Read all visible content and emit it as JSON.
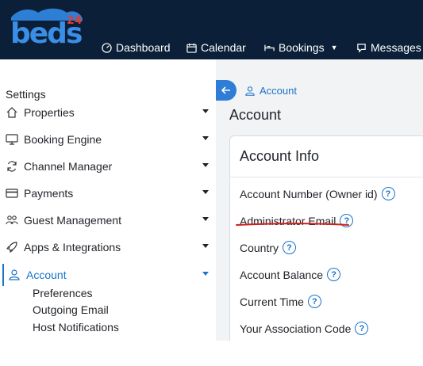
{
  "brand": {
    "logo_text": "beds",
    "logo_badge": "24"
  },
  "nav": {
    "items": [
      {
        "label": "Dashboard",
        "icon": "gauge-icon"
      },
      {
        "label": "Calendar",
        "icon": "calendar-icon"
      },
      {
        "label": "Bookings",
        "icon": "bookings-icon",
        "dropdown": true
      },
      {
        "label": "Messages",
        "icon": "message-icon"
      }
    ]
  },
  "sidebar": {
    "title": "Settings",
    "items": [
      {
        "label": "Properties",
        "icon": "home-icon"
      },
      {
        "label": "Booking Engine",
        "icon": "monitor-icon"
      },
      {
        "label": "Channel Manager",
        "icon": "sync-icon"
      },
      {
        "label": "Payments",
        "icon": "card-icon"
      },
      {
        "label": "Guest Management",
        "icon": "users-icon"
      },
      {
        "label": "Apps & Integrations",
        "icon": "rocket-icon"
      },
      {
        "label": "Account",
        "icon": "user-icon",
        "active": true
      }
    ],
    "submenu": [
      "Preferences",
      "Outgoing Email",
      "Host Notifications"
    ]
  },
  "main": {
    "breadcrumb": "Account",
    "title": "Account",
    "card_title": "Account Info",
    "fields": [
      "Account Number (Owner id)",
      "Administrator Email",
      "Country",
      "Account Balance",
      "Current Time",
      "Your Association Code"
    ],
    "help_glyph": "?"
  },
  "colors": {
    "topbar": "#0b2038",
    "accent": "#1a73c8",
    "annotation": "#d0201a",
    "main_bg": "#f1f3f5"
  }
}
